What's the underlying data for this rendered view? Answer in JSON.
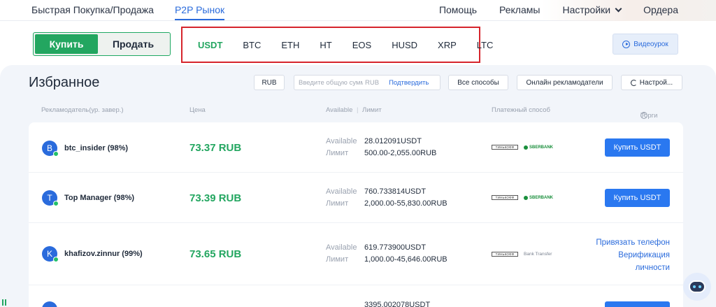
{
  "nav": {
    "left": [
      "Быстрая Покупка/Продажа",
      "P2P Рынок"
    ],
    "right": [
      "Помощь",
      "Рекламы",
      "Настройки",
      "Ордера"
    ]
  },
  "trade": {
    "buy": "Купить",
    "sell": "Продать"
  },
  "coins": [
    "USDT",
    "BTC",
    "ETH",
    "HT",
    "EOS",
    "HUSD",
    "XRP",
    "LTC"
  ],
  "video_label": "Видеоурок",
  "title": "Избранное",
  "filters": {
    "currency": "RUB",
    "amount_placeholder": "Введите общую сумму",
    "amount_currency": "RUB",
    "confirm": "Подтвердить",
    "methods": "Все способы",
    "online": "Онлайн рекламодатели",
    "settings": "Настрой..."
  },
  "columns": {
    "advertiser": "Рекламодатель(ур. завер.)",
    "price": "Цена",
    "available": "Available",
    "sep": "|",
    "limit": "Лимит",
    "payment": "Платежный способ",
    "trade": "Торги"
  },
  "labels": {
    "available": "Available",
    "limit": "Лимит"
  },
  "rows": [
    {
      "initial": "B",
      "merchant": "btc_insider (98%)",
      "price": "73.37 RUB",
      "available": "28.012091USDT",
      "limit": "500.00-2,055.00RUB",
      "pay1": "ТИНЬКОФФ",
      "pay2": "SBERBANK",
      "action": "Купить USDT"
    },
    {
      "initial": "T",
      "merchant": "Top Manager (98%)",
      "price": "73.39 RUB",
      "available": "760.733814USDT",
      "limit": "2,000.00-55,830.00RUB",
      "pay1": "ТИНЬКОФФ",
      "pay2": "SBERBANK",
      "action": "Купить USDT"
    },
    {
      "initial": "K",
      "merchant": "khafizov.zinnur (99%)",
      "price": "73.65 RUB",
      "available": "619.773900USDT",
      "limit": "1,000.00-45,646.00RUB",
      "pay1": "ТИНЬКОФФ",
      "pay2": "Bank Transfer",
      "verify": [
        "Привязать телефон",
        "Верификация",
        "личности"
      ]
    },
    {
      "available": "3395.002078USDT"
    }
  ],
  "colors": {
    "accent": "#2a6bdc",
    "buy_green": "#23a660",
    "highlight_box": "#d6242c",
    "button_blue": "#2a78f0"
  }
}
